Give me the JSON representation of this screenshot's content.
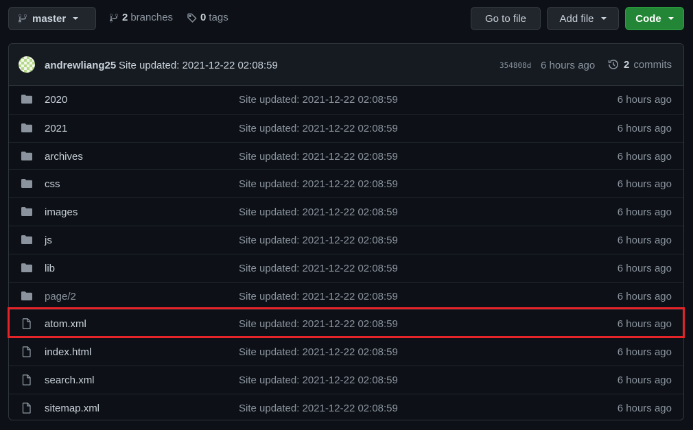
{
  "toolbar": {
    "branch": "master",
    "branches_count": "2",
    "branches_label": "branches",
    "tags_count": "0",
    "tags_label": "tags",
    "goto_file": "Go to file",
    "add_file": "Add file",
    "code": "Code",
    "code_color": "#238636"
  },
  "latest_commit": {
    "author": "andrewliang25",
    "message": "Site updated: 2021-12-22 02:08:59",
    "sha": "354808d",
    "age": "6 hours ago",
    "commits_count": "2",
    "commits_label": "commits"
  },
  "files": [
    {
      "name": "2020",
      "type": "folder",
      "message": "Site updated: 2021-12-22 02:08:59",
      "age": "6 hours ago"
    },
    {
      "name": "2021",
      "type": "folder",
      "message": "Site updated: 2021-12-22 02:08:59",
      "age": "6 hours ago"
    },
    {
      "name": "archives",
      "type": "folder",
      "message": "Site updated: 2021-12-22 02:08:59",
      "age": "6 hours ago"
    },
    {
      "name": "css",
      "type": "folder",
      "message": "Site updated: 2021-12-22 02:08:59",
      "age": "6 hours ago"
    },
    {
      "name": "images",
      "type": "folder",
      "message": "Site updated: 2021-12-22 02:08:59",
      "age": "6 hours ago"
    },
    {
      "name": "js",
      "type": "folder",
      "message": "Site updated: 2021-12-22 02:08:59",
      "age": "6 hours ago"
    },
    {
      "name": "lib",
      "type": "folder",
      "message": "Site updated: 2021-12-22 02:08:59",
      "age": "6 hours ago"
    },
    {
      "name": "page/2",
      "type": "folder",
      "message": "Site updated: 2021-12-22 02:08:59",
      "age": "6 hours ago"
    },
    {
      "name": "atom.xml",
      "type": "file",
      "message": "Site updated: 2021-12-22 02:08:59",
      "age": "6 hours ago"
    },
    {
      "name": "index.html",
      "type": "file",
      "message": "Site updated: 2021-12-22 02:08:59",
      "age": "6 hours ago"
    },
    {
      "name": "search.xml",
      "type": "file",
      "message": "Site updated: 2021-12-22 02:08:59",
      "age": "6 hours ago"
    },
    {
      "name": "sitemap.xml",
      "type": "file",
      "message": "Site updated: 2021-12-22 02:08:59",
      "age": "6 hours ago"
    }
  ],
  "highlight_color": "#e5242a"
}
